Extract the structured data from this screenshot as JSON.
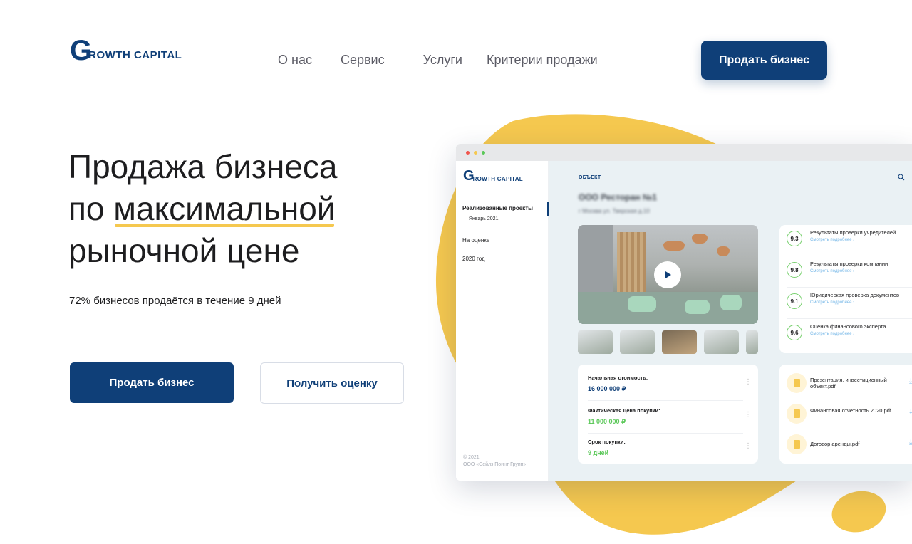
{
  "header": {
    "logo_initial": "G",
    "logo_rest": "ROWTH CAPITAL",
    "nav": [
      "О нас",
      "Сервис",
      "Услуги",
      "Критерии продажи"
    ],
    "cta": "Продать бизнес"
  },
  "hero": {
    "title_line1": "Продажа бизнеса",
    "title_line2_prefix": "по ",
    "title_line2_highlight": "максимальной",
    "title_line3": "рыночной цене",
    "subtitle": "72% бизнесов продаётся в течение 9 дней",
    "primary_button": "Продать бизнес",
    "secondary_button": "Получить оценку"
  },
  "mockup": {
    "logo_initial": "G",
    "logo_rest": "ROWTH CAPITAL",
    "sidebar": {
      "active_item": "Реализованные проекты",
      "active_sub": "— Январь 2021",
      "item2": "На оценке",
      "item3": "2020 год",
      "footer_line1": "© 2021",
      "footer_line2": "ООО «Сейлз Поинт Групп»"
    },
    "section_label": "ОБЪЕКТ",
    "checks": [
      {
        "score": "9.3",
        "title": "Результаты проверки учредителей",
        "more": "Смотреть подробнее ›"
      },
      {
        "score": "9.8",
        "title": "Результаты проверки компании",
        "more": "Смотреть подробнее ›"
      },
      {
        "score": "9.1",
        "title": "Юридическая проверка документов",
        "more": "Смотреть подробнее ›"
      },
      {
        "score": "9.6",
        "title": "Оценка финансового эксперта",
        "more": "Смотреть подробнее ›"
      }
    ],
    "prices": [
      {
        "label": "Начальная стоимость:",
        "value": "16 000 000 ₽"
      },
      {
        "label": "Фактическая цена покупки:",
        "value": "11 000 000 ₽"
      },
      {
        "label": "Срок покупки:",
        "value": "9 дней"
      }
    ],
    "documents": [
      "Презентация, инвестиционный объект.pdf",
      "Финансовая отчетность 2020.pdf",
      "Договор аренды.pdf"
    ]
  },
  "colors": {
    "brand": "#0f3f78",
    "accent_yellow": "#f5c84f",
    "green": "#77d06d",
    "link_blue": "#79b9e8"
  }
}
